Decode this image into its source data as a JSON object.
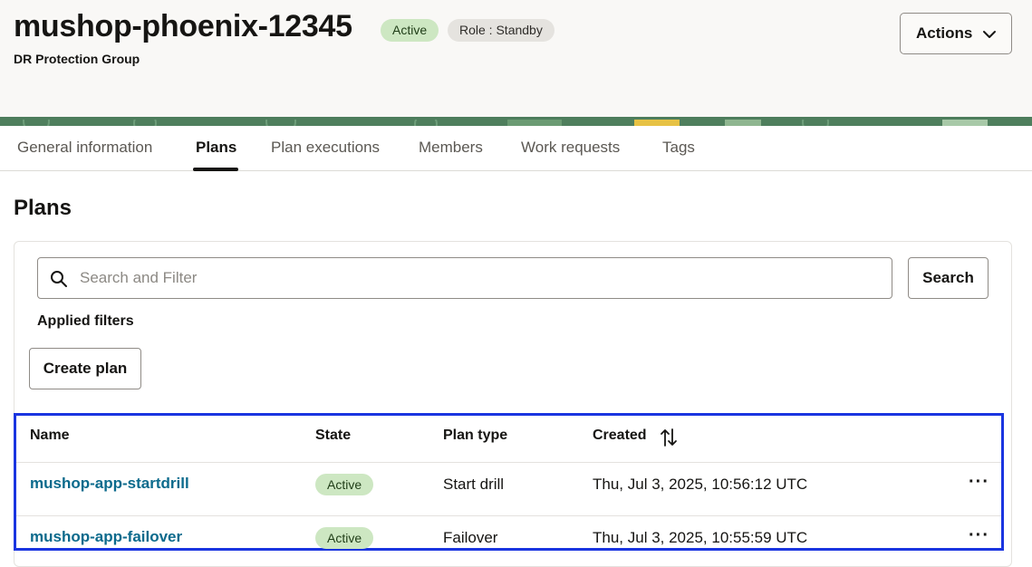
{
  "header": {
    "title": "mushop-phoenix-12345",
    "status_badge": "Active",
    "role_badge": "Role : Standby",
    "subtitle": "DR Protection Group",
    "actions_label": "Actions"
  },
  "tabs": [
    {
      "label": "General information",
      "active": false
    },
    {
      "label": "Plans",
      "active": true
    },
    {
      "label": "Plan executions",
      "active": false
    },
    {
      "label": "Members",
      "active": false
    },
    {
      "label": "Work requests",
      "active": false
    },
    {
      "label": "Tags",
      "active": false
    }
  ],
  "plans": {
    "section_title": "Plans",
    "search_placeholder": "Search and Filter",
    "search_button": "Search",
    "applied_filters_label": "Applied filters",
    "create_button": "Create plan",
    "columns": [
      "Name",
      "State",
      "Plan type",
      "Created"
    ],
    "rows": [
      {
        "name": "mushop-app-startdrill",
        "state": "Active",
        "plan_type": "Start drill",
        "created": "Thu, Jul 3, 2025, 10:56:12 UTC"
      },
      {
        "name": "mushop-app-failover",
        "state": "Active",
        "plan_type": "Failover",
        "created": "Thu, Jul 3, 2025, 10:55:59 UTC"
      }
    ]
  },
  "colors": {
    "active_badge_bg": "#cde7c2",
    "link": "#0b6a8c",
    "highlight_border": "#1a35e0"
  }
}
